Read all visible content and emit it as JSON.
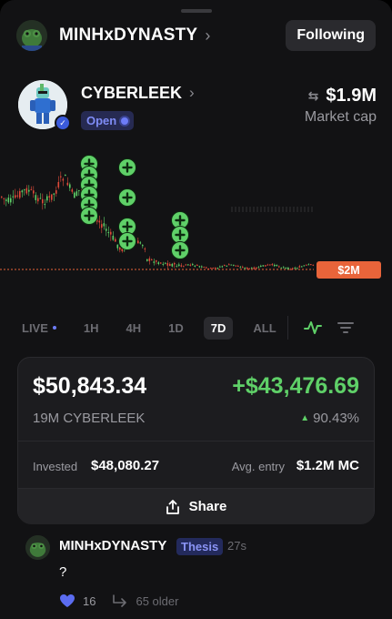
{
  "header": {
    "username": "MINHxDYNASTY",
    "follow_label": "Following"
  },
  "token": {
    "name": "CYBERLEEK",
    "status": "Open",
    "market_cap": "$1.9M",
    "market_cap_label": "Market cap"
  },
  "chart": {
    "price_tag": "$2M",
    "colors": {
      "up": "#5fd068",
      "down": "#e04a3a",
      "baseline": "#e8643a"
    }
  },
  "timeframes": [
    "LIVE",
    "1H",
    "4H",
    "1D",
    "7D",
    "ALL"
  ],
  "active_timeframe": "7D",
  "position": {
    "value": "$50,843.34",
    "pnl": "+$43,476.69",
    "holdings": "19M CYBERLEEK",
    "pnl_percent": "90.43%",
    "invested_label": "Invested",
    "invested_value": "$48,080.27",
    "avg_entry_label": "Avg. entry",
    "avg_entry_value": "$1.2M MC",
    "share_label": "Share"
  },
  "comment": {
    "author": "MINHxDYNASTY",
    "tag": "Thesis",
    "time": "27s",
    "body": "?",
    "likes": "16",
    "older": "65 older"
  }
}
